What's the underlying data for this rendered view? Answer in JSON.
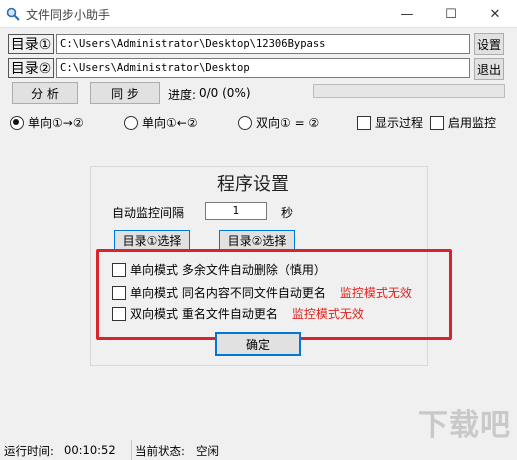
{
  "window": {
    "title": "文件同步小助手"
  },
  "dir1": {
    "label": "目录①",
    "path": "C:\\Users\\Administrator\\Desktop\\12306Bypass",
    "button": "设置"
  },
  "dir2": {
    "label": "目录②",
    "path": "C:\\Users\\Administrator\\Desktop",
    "button": "退出"
  },
  "actions": {
    "analyze": "分 析",
    "sync": "同 步",
    "progress_label": "进度:",
    "progress_text": "0/0 (0%)",
    "progress_value": 0
  },
  "modes": [
    {
      "label": "单向①→②",
      "selected": true
    },
    {
      "label": "单向①←②",
      "selected": false
    },
    {
      "label": "双向① = ②",
      "selected": false
    }
  ],
  "toggles": {
    "show_process": "显示过程",
    "enable_monitor": "启用监控"
  },
  "settings": {
    "title": "程序设置",
    "interval_label": "自动监控间隔",
    "interval_value": "1",
    "interval_unit": "秒",
    "select_dir1": "目录①选择",
    "select_dir2": "目录②选择",
    "options": [
      {
        "text": "单向模式  多余文件自动删除（慎用）",
        "note": ""
      },
      {
        "text": "单向模式  同名内容不同文件自动更名",
        "note": "监控模式无效"
      },
      {
        "text": "双向模式  重名文件自动更名",
        "note": "监控模式无效"
      }
    ],
    "confirm": "确定"
  },
  "status": {
    "runtime_label": "运行时间:",
    "runtime": "00:10:52",
    "state_label": "当前状态:",
    "state": "空闲"
  },
  "watermark": "下载吧"
}
